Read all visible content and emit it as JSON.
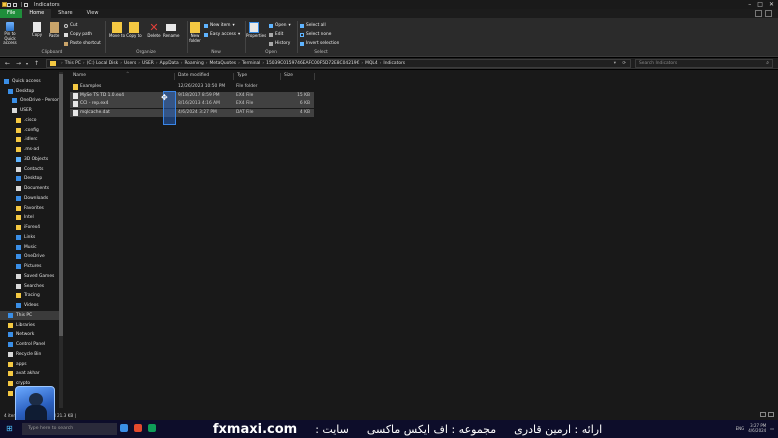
{
  "window": {
    "title": "Indicators",
    "controls": {
      "minimize": "–",
      "maximize": "□",
      "close": "✕"
    }
  },
  "tabs": [
    "File",
    "Home",
    "Share",
    "View"
  ],
  "ribbon": {
    "clipboard": {
      "label": "Clipboard",
      "pin": "Pin to Quick access",
      "copy": "Copy",
      "paste": "Paste",
      "cut": "Cut",
      "copy_path": "Copy path",
      "paste_shortcut": "Paste shortcut"
    },
    "organize": {
      "label": "Organize",
      "move_to": "Move to",
      "copy_to": "Copy to",
      "delete": "Delete",
      "rename": "Rename"
    },
    "new": {
      "label": "New",
      "new_folder": "New folder",
      "new_item": "New item",
      "easy_access": "Easy access"
    },
    "open": {
      "label": "Open",
      "properties": "Properties",
      "open": "Open",
      "edit": "Edit",
      "history": "History"
    },
    "select": {
      "label": "Select",
      "select_all": "Select all",
      "select_none": "Select none",
      "invert": "Invert selection"
    }
  },
  "address": {
    "crumbs": [
      "This PC",
      "(C:) Local Disk",
      "Users",
      "USER",
      "AppData",
      "Roaming",
      "MetaQuotes",
      "Terminal",
      "15039C0159746EAFC00F5D72E8C04219€",
      "MQL4",
      "Indicators"
    ],
    "search_placeholder": "Search Indicators"
  },
  "nav": {
    "items": [
      {
        "label": "Quick access",
        "icon": "star-icon",
        "color": "#3a8ee6",
        "indent": 0
      },
      {
        "label": "Desktop",
        "icon": "desktop-icon",
        "color": "#3a8ee6",
        "indent": 1
      },
      {
        "label": "OneDrive - Person",
        "icon": "cloud-icon",
        "color": "#3a8ee6",
        "indent": 2
      },
      {
        "label": "USER",
        "icon": "user-icon",
        "color": "#d8d8d8",
        "indent": 2
      },
      {
        "label": ".cisco",
        "icon": "folder-icon",
        "color": "#f4c842",
        "indent": 3
      },
      {
        "label": ".config",
        "icon": "folder-icon",
        "color": "#f4c842",
        "indent": 3
      },
      {
        "label": ".idlerc",
        "icon": "folder-icon",
        "color": "#f4c842",
        "indent": 3
      },
      {
        "label": ".ms-ad",
        "icon": "folder-icon",
        "color": "#f4c842",
        "indent": 3
      },
      {
        "label": "3D Objects",
        "icon": "cube-icon",
        "color": "#5fb4ff",
        "indent": 3
      },
      {
        "label": "Contacts",
        "icon": "contacts-icon",
        "color": "#d8d8d8",
        "indent": 3
      },
      {
        "label": "Desktop",
        "icon": "desktop-icon",
        "color": "#3a8ee6",
        "indent": 3
      },
      {
        "label": "Documents",
        "icon": "document-icon",
        "color": "#d8d8d8",
        "indent": 3
      },
      {
        "label": "Downloads",
        "icon": "download-icon",
        "color": "#3a8ee6",
        "indent": 3
      },
      {
        "label": "Favorites",
        "icon": "star-icon",
        "color": "#f4c842",
        "indent": 3
      },
      {
        "label": "Intel",
        "icon": "folder-icon",
        "color": "#f4c842",
        "indent": 3
      },
      {
        "label": "iForex4",
        "icon": "folder-icon",
        "color": "#f4c842",
        "indent": 3
      },
      {
        "label": "Links",
        "icon": "link-icon",
        "color": "#3a8ee6",
        "indent": 3
      },
      {
        "label": "Music",
        "icon": "music-icon",
        "color": "#3a8ee6",
        "indent": 3
      },
      {
        "label": "OneDrive",
        "icon": "cloud-icon",
        "color": "#3a8ee6",
        "indent": 3
      },
      {
        "label": "Pictures",
        "icon": "pictures-icon",
        "color": "#3a8ee6",
        "indent": 3
      },
      {
        "label": "Saved Games",
        "icon": "games-icon",
        "color": "#d8d8d8",
        "indent": 3
      },
      {
        "label": "Searches",
        "icon": "search-icon",
        "color": "#d8d8d8",
        "indent": 3
      },
      {
        "label": "Tracing",
        "icon": "folder-icon",
        "color": "#f4c842",
        "indent": 3
      },
      {
        "label": "Videos",
        "icon": "video-icon",
        "color": "#3a8ee6",
        "indent": 3
      },
      {
        "label": "This PC",
        "icon": "computer-icon",
        "color": "#3a8ee6",
        "indent": 1,
        "selected": true
      },
      {
        "label": "Libraries",
        "icon": "library-icon",
        "color": "#f4c842",
        "indent": 1
      },
      {
        "label": "Network",
        "icon": "network-icon",
        "color": "#3a8ee6",
        "indent": 1
      },
      {
        "label": "Control Panel",
        "icon": "control-panel-icon",
        "color": "#3a8ee6",
        "indent": 1
      },
      {
        "label": "Recycle Bin",
        "icon": "recycle-bin-icon",
        "color": "#d8d8d8",
        "indent": 1
      },
      {
        "label": "apps",
        "icon": "folder-icon",
        "color": "#f4c842",
        "indent": 1
      },
      {
        "label": "avat akhar",
        "icon": "folder-icon",
        "color": "#f4c842",
        "indent": 1
      },
      {
        "label": "crypto",
        "icon": "folder-icon",
        "color": "#f4c842",
        "indent": 1
      },
      {
        "label": "LS Files",
        "icon": "folder-icon",
        "color": "#f4c842",
        "indent": 1
      }
    ]
  },
  "columns": {
    "name": "Name",
    "date": "Date modified",
    "type": "Type",
    "size": "Size"
  },
  "files": [
    {
      "name": "Examples",
      "date": "12/26/2023 10:50 PM",
      "type": "File folder",
      "size": "",
      "icon": "folder-icon",
      "color": "#f4c842",
      "selected": false
    },
    {
      "name": "MySe     TS TD 1.0.ex4",
      "date": "9/18/2017 8:59 PM",
      "type": "EX4 File",
      "size": "15 KB",
      "icon": "file-icon",
      "color": "#e8e8e8",
      "selected": true
    },
    {
      "name": "CCI - rep.ex4",
      "date": "8/16/2013 4:16 AM",
      "type": "EX4 File",
      "size": "6 KB",
      "icon": "file-icon",
      "color": "#e8e8e8",
      "selected": true
    },
    {
      "name": "mqlcache.dat",
      "date": "4/6/2024 3:27 PM",
      "type": "DAT File",
      "size": "4 KB",
      "icon": "file-icon",
      "color": "#e8e8e8",
      "selected": true
    }
  ],
  "status": {
    "text": "4 items    2 items selected  21.3 KB  |"
  },
  "taskbar": {
    "search_placeholder": "Type here to search",
    "banner_ar1": "ارائه : ارمین قادری",
    "banner_ar2": "مجموعه : اف ایکس ماکسی",
    "banner_ar3": "سایت :",
    "brand": "fxmaxi.com",
    "lang": "ENG",
    "time": "3:27 PM",
    "date": "4/6/2024"
  }
}
